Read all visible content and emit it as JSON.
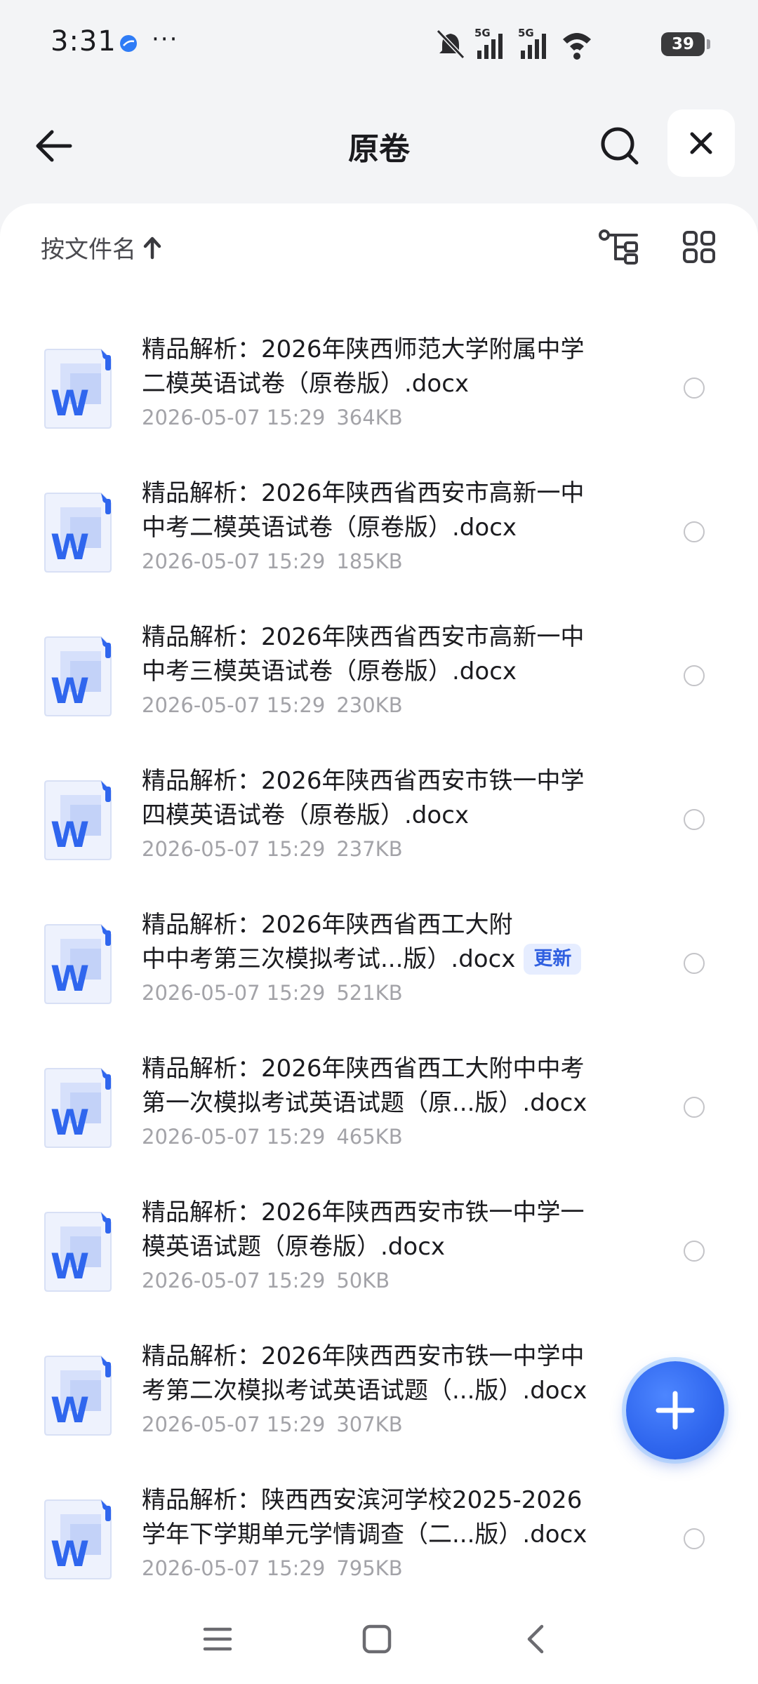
{
  "status_bar": {
    "time": "3:31",
    "more": "···",
    "battery": "39",
    "icons": [
      "app-dot-icon",
      "mute-icon",
      "signal-5g-icon",
      "signal-5g-icon",
      "wifi-icon",
      "battery-icon"
    ]
  },
  "header": {
    "title": "原卷",
    "icons": [
      "back-arrow-icon",
      "search-icon",
      "close-icon"
    ]
  },
  "sort_bar": {
    "label": "按文件名",
    "icons": [
      "sort-up-arrow-icon",
      "tree-view-icon",
      "grid-view-icon"
    ]
  },
  "files": [
    {
      "name_line1": "精品解析：2026年陕西师范大学附属中学",
      "name_line2": "二模英语试卷（原卷版）.docx",
      "date": "2026-05-07 15:29",
      "size": "364KB",
      "badge": ""
    },
    {
      "name_line1": "精品解析：2026年陕西省西安市高新一中",
      "name_line2": "中考二模英语试卷（原卷版）.docx",
      "date": "2026-05-07 15:29",
      "size": "185KB",
      "badge": ""
    },
    {
      "name_line1": "精品解析：2026年陕西省西安市高新一中",
      "name_line2": "中考三模英语试卷（原卷版）.docx",
      "date": "2026-05-07 15:29",
      "size": "230KB",
      "badge": ""
    },
    {
      "name_line1": "精品解析：2026年陕西省西安市铁一中学",
      "name_line2": "四模英语试卷（原卷版）.docx",
      "date": "2026-05-07 15:29",
      "size": "237KB",
      "badge": ""
    },
    {
      "name_line1": "精品解析：2026年陕西省西工大附",
      "name_line2": "中中考第三次模拟考试...版）.docx",
      "date": "2026-05-07 15:29",
      "size": "521KB",
      "badge": "更新"
    },
    {
      "name_line1": "精品解析：2026年陕西省西工大附中中考",
      "name_line2": "第一次模拟考试英语试题（原...版）.docx",
      "date": "2026-05-07 15:29",
      "size": "465KB",
      "badge": ""
    },
    {
      "name_line1": "精品解析：2026年陕西西安市铁一中学一",
      "name_line2": "模英语试题（原卷版）.docx",
      "date": "2026-05-07 15:29",
      "size": "50KB",
      "badge": ""
    },
    {
      "name_line1": "精品解析：2026年陕西西安市铁一中学中",
      "name_line2": "考第二次模拟考试英语试题（...版）.docx",
      "date": "2026-05-07 15:29",
      "size": "307KB",
      "badge": ""
    },
    {
      "name_line1": "精品解析：陕西西安滨河学校2025-2026",
      "name_line2": "学年下学期单元学情调查（二...版）.docx",
      "date": "2026-05-07 15:29",
      "size": "795KB",
      "badge": ""
    }
  ],
  "file_icon": {
    "label": "W",
    "name": "word-doc-icon"
  },
  "fab": {
    "icon": "plus-icon"
  },
  "nav_bar": {
    "icons": [
      "menu-icon",
      "home-square-icon",
      "back-chevron-icon"
    ]
  },
  "colors": {
    "accent": "#2f66ee",
    "badge_bg": "#e6edff",
    "badge_text": "#2f5fe0",
    "meta_text": "#a3a3a8",
    "background": "#f3f4f6"
  }
}
